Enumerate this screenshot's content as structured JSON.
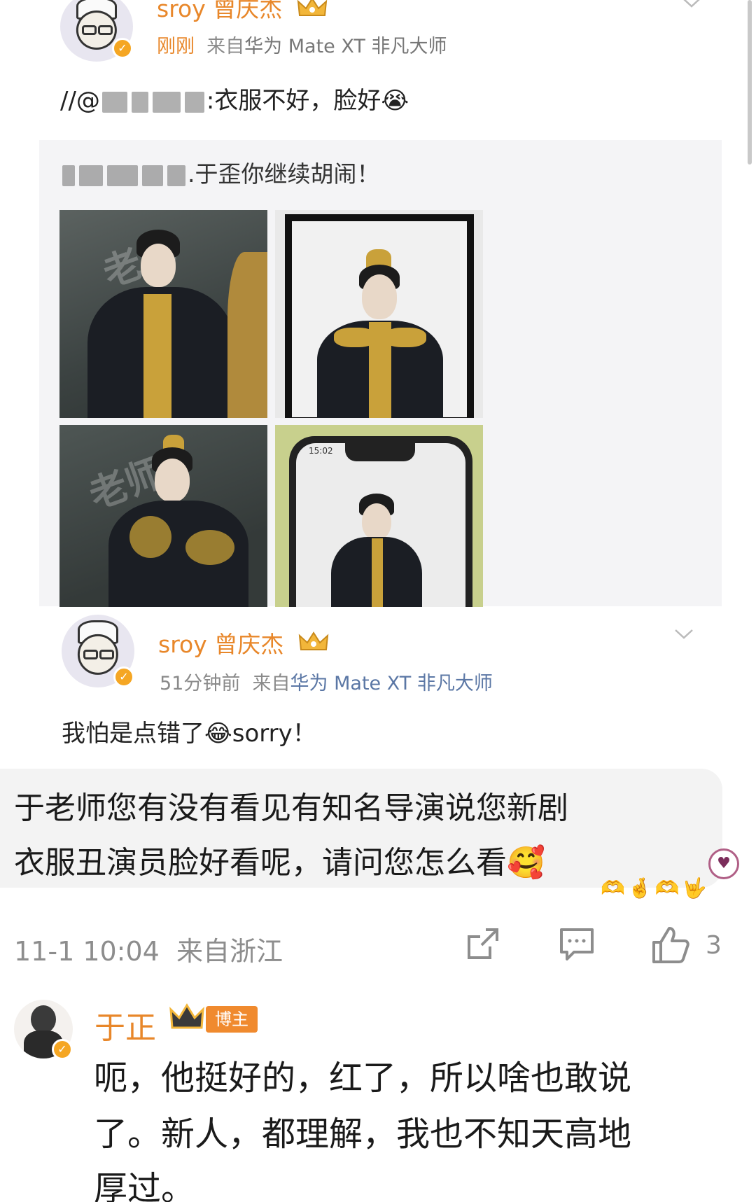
{
  "post1": {
    "username": "sroy 曾庆杰",
    "time": "刚刚",
    "source_prefix": "来自",
    "device": "华为 Mate XT 非凡大师",
    "repost_prefix": "//@",
    "repost_text": ":衣服不好，脸好",
    "quoted_text": ".于歪你继续胡闹！",
    "crying_emoji": "😭"
  },
  "post2": {
    "username": "sroy 曾庆杰",
    "time": "51分钟前",
    "source_prefix": "来自",
    "device": "华为 Mate XT 非凡大师",
    "body": "我怕是点错了",
    "emoji": "😂",
    "body_tail": "sorry！"
  },
  "comment": {
    "line1": "于老师您有没有看见有知名导演说您新剧",
    "line2": "衣服丑演员脸好看呢，请问您怎么看",
    "emoji": "🥰",
    "reactions": "🫶🤞🫶🤟",
    "time": "11-1 10:04",
    "location": "来自浙江",
    "like_count": "3"
  },
  "reply": {
    "username": "于正",
    "badge": "博主",
    "lines": [
      "呃，他挺好的，红了，所以啥也敢说",
      "了。新人，都理解，我也不知天高地",
      "厚过。"
    ]
  },
  "photo_watermark": "老师",
  "phone_time": "15:02",
  "colors": {
    "username": "#e8872a",
    "device": "#5b77a5",
    "meta": "#8a8a8a",
    "badge": "#f08a2e"
  },
  "icons": [
    "crown-icon",
    "verified-icon",
    "chevron-down-icon",
    "share-icon",
    "comment-icon",
    "like-icon"
  ]
}
